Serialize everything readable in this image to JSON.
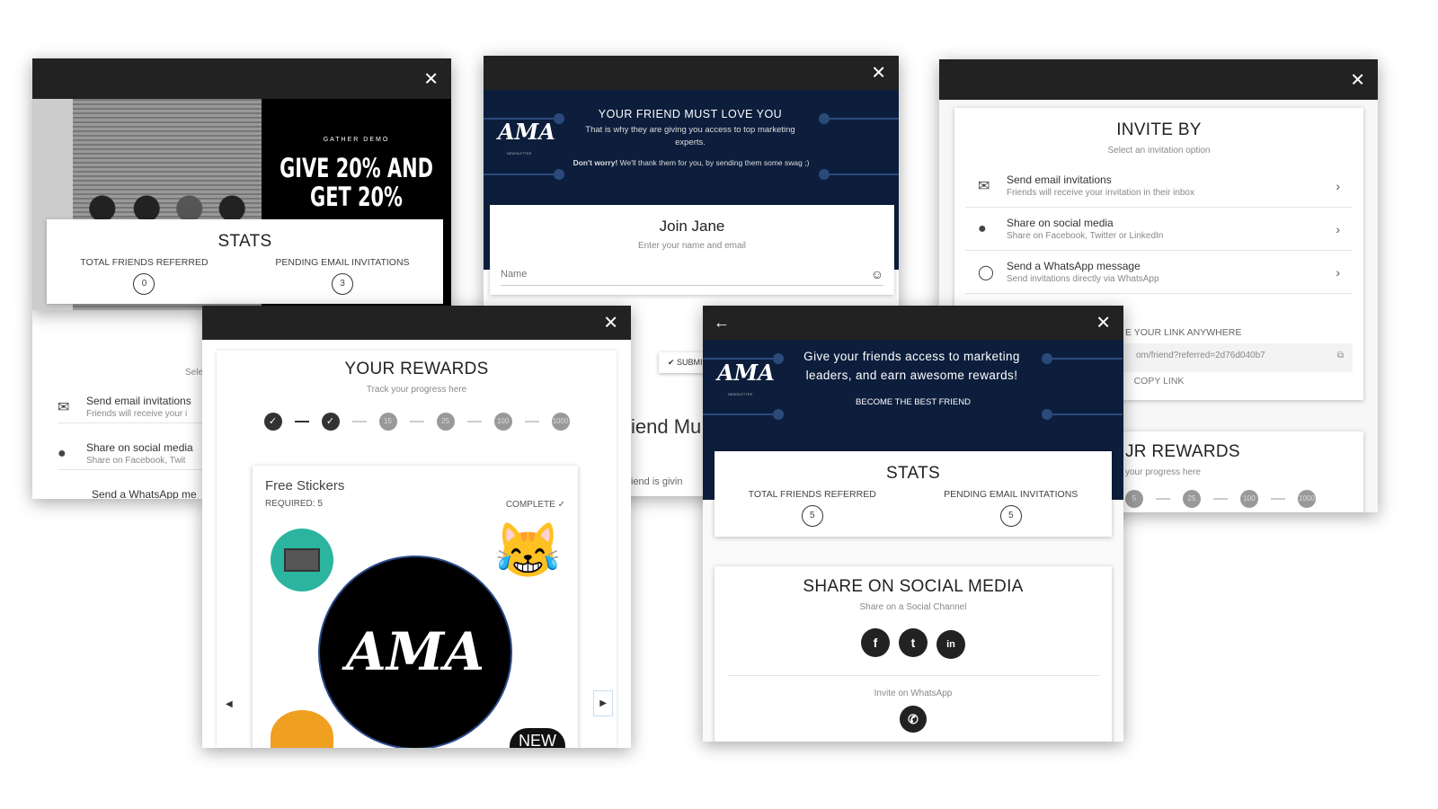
{
  "gather": {
    "brand": "GATHER DEMO",
    "headline": "GIVE 20% AND GET 20%",
    "stats": {
      "title": "STATS",
      "total_label": "TOTAL FRIENDS REFERRED",
      "total_value": "0",
      "pending_label": "PENDING EMAIL INVITATIONS",
      "pending_value": "3"
    }
  },
  "behind_invite": {
    "select": "Sele",
    "email_title": "Send email invitations",
    "email_desc": "Friends will receive your i",
    "social_title": "Share on social media",
    "social_desc": "Share on Facebook, Twit",
    "whatsapp_title": "Send a WhatsApp me"
  },
  "join": {
    "logo": "AMA",
    "logo_sub": "NEWSLETTER",
    "headline": "YOUR FRIEND MUST LOVE YOU",
    "text": "That is why they are giving you access to top marketing experts.",
    "note_bold": "Don't worry!",
    "note": " We'll thank them for you, by sending them some swag ;)",
    "card_title": "Join Jane",
    "card_sub": "Enter your name and email",
    "name_placeholder": "Name",
    "submit": "SUBMIT",
    "partial_heading": "iend Mu",
    "partial_text": "iend is givin"
  },
  "invite": {
    "title": "INVITE BY",
    "subtitle": "Select an invitation option",
    "options": [
      {
        "title": "Send email invitations",
        "desc": "Friends will receive your invitation in their inbox",
        "icon": "envelope-icon"
      },
      {
        "title": "Share on social media",
        "desc": "Share on Facebook, Twitter or LinkedIn",
        "icon": "facebook-icon"
      },
      {
        "title": "Send a WhatsApp message",
        "desc": "Send invitations directly via WhatsApp",
        "icon": "whatsapp-icon"
      }
    ],
    "link_label": "E YOUR LINK ANYWHERE",
    "link_value": "om/friend?referred=2d76d040b7",
    "copy": "COPY LINK",
    "rewards_title": "JR REWARDS",
    "rewards_sub": "your progress here",
    "steps": [
      "5",
      "25",
      "100",
      "1000"
    ]
  },
  "rewards": {
    "title": "YOUR REWARDS",
    "subtitle": "Track your progress here",
    "steps": [
      {
        "label": "✓",
        "done": true
      },
      {
        "label": "✓",
        "done": true
      },
      {
        "label": "15",
        "done": false
      },
      {
        "label": "25",
        "done": false
      },
      {
        "label": "100",
        "done": false
      },
      {
        "label": "1000",
        "done": false
      }
    ],
    "reward_name": "Free Stickers",
    "required": "REQUIRED: 5",
    "status": "COMPLETE",
    "logo": "AMA",
    "badge": "NEW"
  },
  "friend": {
    "logo": "AMA",
    "logo_sub": "NEWSLETTER",
    "headline": "Give your friends access to marketing leaders, and earn awesome rewards!",
    "cta": "BECOME THE BEST FRIEND",
    "stats": {
      "title": "STATS",
      "total_label": "TOTAL FRIENDS REFERRED",
      "total_value": "5",
      "pending_label": "PENDING EMAIL INVITATIONS",
      "pending_value": "5"
    },
    "share_title": "SHARE ON SOCIAL MEDIA",
    "share_sub": "Share on a Social Channel",
    "whatsapp_label": "Invite on WhatsApp"
  },
  "colors": {
    "header": "#222222",
    "navy": "#0c1e3c",
    "teal": "#2bb5a0"
  }
}
